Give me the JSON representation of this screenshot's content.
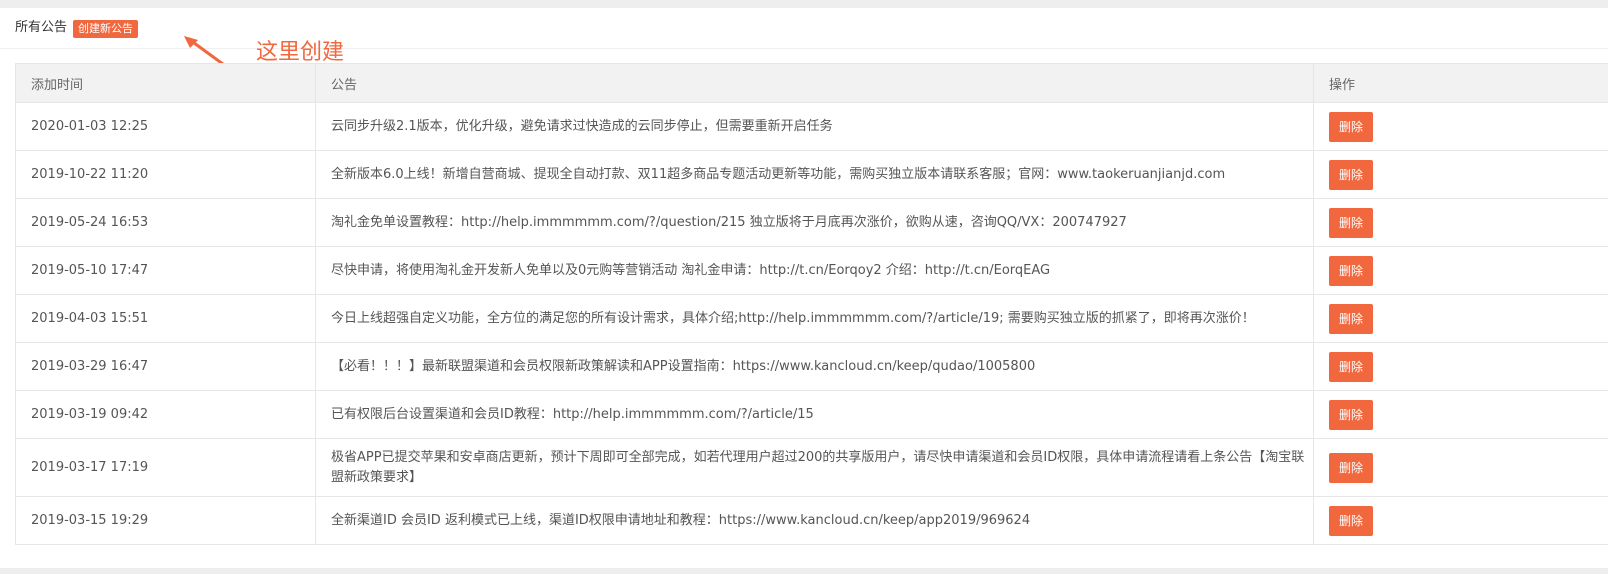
{
  "header": {
    "title": "所有公告",
    "create_button": "创建新公告",
    "hint": "这里创建"
  },
  "table": {
    "columns": [
      "添加时间",
      "公告",
      "操作"
    ],
    "rows": [
      {
        "time": "2020-01-03 12:25",
        "notice": "云同步升级2.1版本，优化升级，避免请求过快造成的云同步停止，但需要重新开启任务",
        "action": "删除"
      },
      {
        "time": "2019-10-22 11:20",
        "notice": "全新版本6.0上线！新增自营商城、提现全自动打款、双11超多商品专题活动更新等功能，需购买独立版本请联系客服；官网：www.taokeruanjianjd.com",
        "action": "删除"
      },
      {
        "time": "2019-05-24 16:53",
        "notice": "淘礼金免单设置教程：http://help.immmmmm.com/?/question/215 独立版将于月底再次涨价，欲购从速，咨询QQ/VX：200747927",
        "action": "删除"
      },
      {
        "time": "2019-05-10 17:47",
        "notice": "尽快申请，将使用淘礼金开发新人免单以及0元购等营销活动 淘礼金申请：http://t.cn/Eorqoy2 介绍：http://t.cn/EorqEAG",
        "action": "删除"
      },
      {
        "time": "2019-04-03 15:51",
        "notice": "今日上线超强自定义功能，全方位的满足您的所有设计需求，具体介绍;http://help.immmmmm.com/?/article/19; 需要购买独立版的抓紧了，即将再次涨价！",
        "action": "删除"
      },
      {
        "time": "2019-03-29 16:47",
        "notice": "【必看！！！】最新联盟渠道和会员权限新政策解读和APP设置指南：https://www.kancloud.cn/keep/qudao/1005800",
        "action": "删除"
      },
      {
        "time": "2019-03-19 09:42",
        "notice": "已有权限后台设置渠道和会员ID教程：http://help.immmmmm.com/?/article/15",
        "action": "删除"
      },
      {
        "time": "2019-03-17 17:19",
        "notice": "极省APP已提交苹果和安卓商店更新，预计下周即可全部完成，如若代理用户超过200的共享版用户，请尽快申请渠道和会员ID权限，具体申请流程请看上条公告【淘宝联盟新政策要求】",
        "action": "删除"
      },
      {
        "time": "2019-03-15 19:29",
        "notice": "全新渠道ID 会员ID 返利模式已上线，渠道ID权限申请地址和教程：https://www.kancloud.cn/keep/app2019/969624",
        "action": "删除"
      }
    ]
  },
  "colors": {
    "accent": "#f1673e",
    "header_bg": "#f2f2f2",
    "border": "#e6e6e6"
  }
}
